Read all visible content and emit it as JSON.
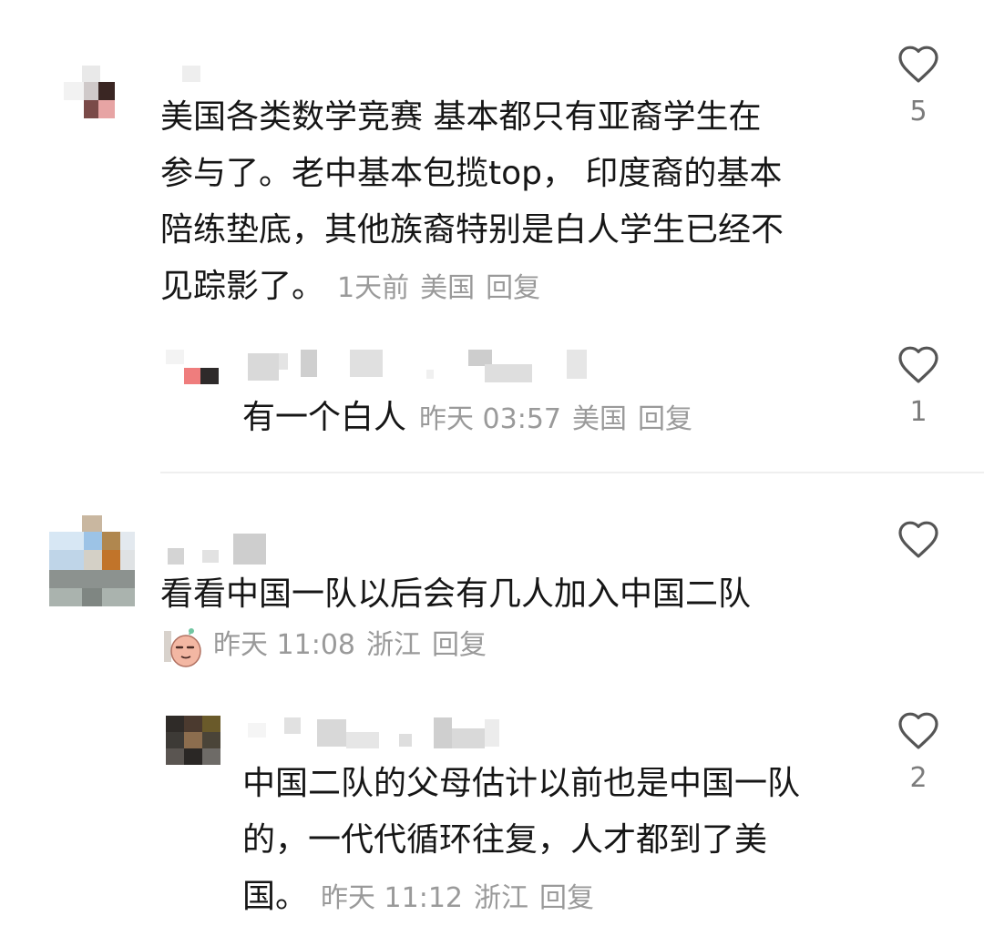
{
  "comments": [
    {
      "text_lines": [
        "美国各类数学竞赛 基本都只有亚裔学生在",
        "参与了。老中基本包揽top， 印度裔的基本",
        "陪练垫底，其他族裔特别是白人学生已经不",
        "见踪影了。"
      ],
      "time": "1天前",
      "location": "美国",
      "reply_label": "回复",
      "likes": "5",
      "replies": [
        {
          "text": "有一个白人",
          "time": "昨天 03:57",
          "location": "美国",
          "reply_label": "回复",
          "likes": "1"
        }
      ]
    },
    {
      "text": "看看中国一队以后会有几人加入中国二队",
      "time": "昨天 11:08",
      "location": "浙江",
      "reply_label": "回复",
      "likes": "",
      "replies": [
        {
          "text_lines": [
            "中国二队的父母估计以前也是中国一队",
            "的，一代代循环往复，人才都到了美",
            "国。"
          ],
          "time": "昨天 11:12",
          "location": "浙江",
          "reply_label": "回复",
          "likes": "2"
        }
      ]
    }
  ],
  "icons": {
    "like": "heart-outline-icon",
    "sticker": "sticker-emoji-icon"
  },
  "colors": {
    "text": "#161616",
    "meta": "#9a9a9a",
    "count": "#7c7c7c",
    "divider": "#efefef"
  }
}
